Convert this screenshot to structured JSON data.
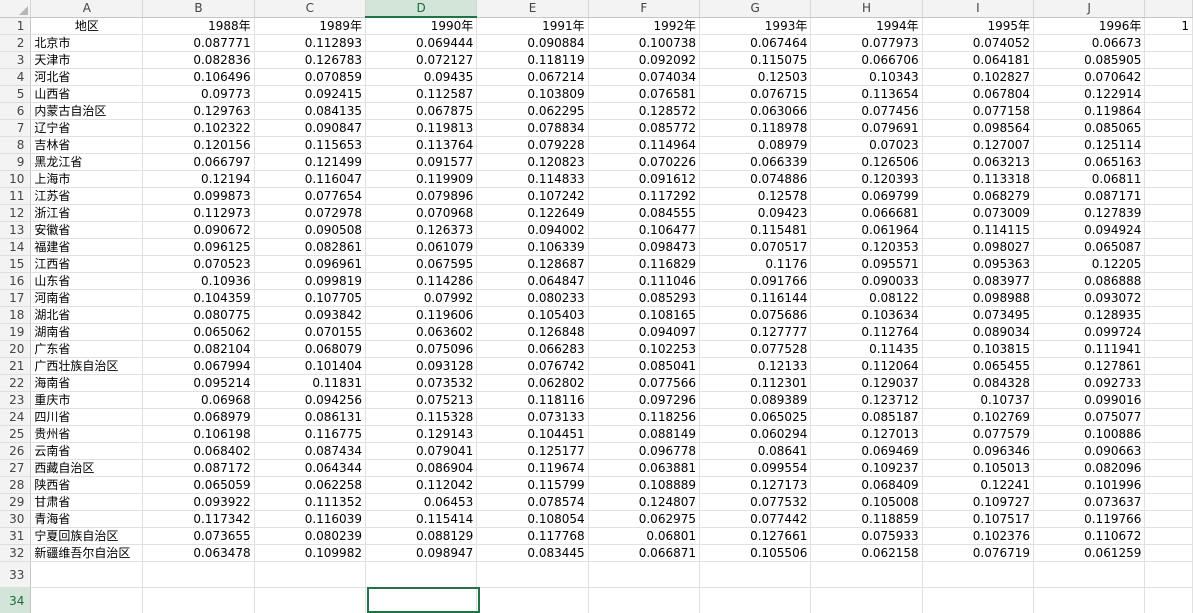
{
  "columns": [
    "A",
    "B",
    "C",
    "D",
    "E",
    "F",
    "G",
    "H",
    "I",
    "J",
    ""
  ],
  "selected_column": "D",
  "selected_row": "34",
  "header_row": [
    "地区",
    "1988年",
    "1989年",
    "1990年",
    "1991年",
    "1992年",
    "1993年",
    "1994年",
    "1995年",
    "1996年",
    "1"
  ],
  "rows": [
    [
      "北京市",
      "0.087771",
      "0.112893",
      "0.069444",
      "0.090884",
      "0.100738",
      "0.067464",
      "0.077973",
      "0.074052",
      "0.06673"
    ],
    [
      "天津市",
      "0.082836",
      "0.126783",
      "0.072127",
      "0.118119",
      "0.092092",
      "0.115075",
      "0.066706",
      "0.064181",
      "0.085905"
    ],
    [
      "河北省",
      "0.106496",
      "0.070859",
      "0.09435",
      "0.067214",
      "0.074034",
      "0.12503",
      "0.10343",
      "0.102827",
      "0.070642"
    ],
    [
      "山西省",
      "0.09773",
      "0.092415",
      "0.112587",
      "0.103809",
      "0.076581",
      "0.076715",
      "0.113654",
      "0.067804",
      "0.122914"
    ],
    [
      "内蒙古自治区",
      "0.129763",
      "0.084135",
      "0.067875",
      "0.062295",
      "0.128572",
      "0.063066",
      "0.077456",
      "0.077158",
      "0.119864"
    ],
    [
      "辽宁省",
      "0.102322",
      "0.090847",
      "0.119813",
      "0.078834",
      "0.085772",
      "0.118978",
      "0.079691",
      "0.098564",
      "0.085065"
    ],
    [
      "吉林省",
      "0.120156",
      "0.115653",
      "0.113764",
      "0.079228",
      "0.114964",
      "0.08979",
      "0.07023",
      "0.127007",
      "0.125114"
    ],
    [
      "黑龙江省",
      "0.066797",
      "0.121499",
      "0.091577",
      "0.120823",
      "0.070226",
      "0.066339",
      "0.126506",
      "0.063213",
      "0.065163"
    ],
    [
      "上海市",
      "0.12194",
      "0.116047",
      "0.119909",
      "0.114833",
      "0.091612",
      "0.074886",
      "0.120393",
      "0.113318",
      "0.06811"
    ],
    [
      "江苏省",
      "0.099873",
      "0.077654",
      "0.079896",
      "0.107242",
      "0.117292",
      "0.12578",
      "0.069799",
      "0.068279",
      "0.087171"
    ],
    [
      "浙江省",
      "0.112973",
      "0.072978",
      "0.070968",
      "0.122649",
      "0.084555",
      "0.09423",
      "0.066681",
      "0.073009",
      "0.127839"
    ],
    [
      "安徽省",
      "0.090672",
      "0.090508",
      "0.126373",
      "0.094002",
      "0.106477",
      "0.115481",
      "0.061964",
      "0.114115",
      "0.094924"
    ],
    [
      "福建省",
      "0.096125",
      "0.082861",
      "0.061079",
      "0.106339",
      "0.098473",
      "0.070517",
      "0.120353",
      "0.098027",
      "0.065087"
    ],
    [
      "江西省",
      "0.070523",
      "0.096961",
      "0.067595",
      "0.128687",
      "0.116829",
      "0.1176",
      "0.095571",
      "0.095363",
      "0.12205"
    ],
    [
      "山东省",
      "0.10936",
      "0.099819",
      "0.114286",
      "0.064847",
      "0.111046",
      "0.091766",
      "0.090033",
      "0.083977",
      "0.086888"
    ],
    [
      "河南省",
      "0.104359",
      "0.107705",
      "0.07992",
      "0.080233",
      "0.085293",
      "0.116144",
      "0.08122",
      "0.098988",
      "0.093072"
    ],
    [
      "湖北省",
      "0.080775",
      "0.093842",
      "0.119606",
      "0.105403",
      "0.108165",
      "0.075686",
      "0.103634",
      "0.073495",
      "0.128935"
    ],
    [
      "湖南省",
      "0.065062",
      "0.070155",
      "0.063602",
      "0.126848",
      "0.094097",
      "0.127777",
      "0.112764",
      "0.089034",
      "0.099724"
    ],
    [
      "广东省",
      "0.082104",
      "0.068079",
      "0.075096",
      "0.066283",
      "0.102253",
      "0.077528",
      "0.11435",
      "0.103815",
      "0.111941"
    ],
    [
      "广西壮族自治区",
      "0.067994",
      "0.101404",
      "0.093128",
      "0.076742",
      "0.085041",
      "0.12133",
      "0.112064",
      "0.065455",
      "0.127861"
    ],
    [
      "海南省",
      "0.095214",
      "0.11831",
      "0.073532",
      "0.062802",
      "0.077566",
      "0.112301",
      "0.129037",
      "0.084328",
      "0.092733"
    ],
    [
      "重庆市",
      "0.06968",
      "0.094256",
      "0.075213",
      "0.118116",
      "0.097296",
      "0.089389",
      "0.123712",
      "0.10737",
      "0.099016"
    ],
    [
      "四川省",
      "0.068979",
      "0.086131",
      "0.115328",
      "0.073133",
      "0.118256",
      "0.065025",
      "0.085187",
      "0.102769",
      "0.075077"
    ],
    [
      "贵州省",
      "0.106198",
      "0.116775",
      "0.129143",
      "0.104451",
      "0.088149",
      "0.060294",
      "0.127013",
      "0.077579",
      "0.100886"
    ],
    [
      "云南省",
      "0.068402",
      "0.087434",
      "0.079041",
      "0.125177",
      "0.096778",
      "0.08641",
      "0.069469",
      "0.096346",
      "0.090663"
    ],
    [
      "西藏自治区",
      "0.087172",
      "0.064344",
      "0.086904",
      "0.119674",
      "0.063881",
      "0.099554",
      "0.109237",
      "0.105013",
      "0.082096"
    ],
    [
      "陕西省",
      "0.065059",
      "0.062258",
      "0.112042",
      "0.115799",
      "0.108889",
      "0.127173",
      "0.068409",
      "0.12241",
      "0.101996"
    ],
    [
      "甘肃省",
      "0.093922",
      "0.111352",
      "0.06453",
      "0.078574",
      "0.124807",
      "0.077532",
      "0.105008",
      "0.109727",
      "0.073637"
    ],
    [
      "青海省",
      "0.117342",
      "0.116039",
      "0.115414",
      "0.108054",
      "0.062975",
      "0.077442",
      "0.118859",
      "0.107517",
      "0.119766"
    ],
    [
      "宁夏回族自治区",
      "0.073655",
      "0.080239",
      "0.088129",
      "0.117768",
      "0.06801",
      "0.127661",
      "0.075933",
      "0.102376",
      "0.110672"
    ],
    [
      "新疆维吾尔自治区",
      "0.063478",
      "0.109982",
      "0.098947",
      "0.083445",
      "0.066871",
      "0.105506",
      "0.062158",
      "0.076719",
      "0.061259"
    ]
  ],
  "empty_rows": [
    "33",
    "34"
  ],
  "colors": {
    "accent": "#217346",
    "selected_header_bg": "#d3e4d8",
    "grid": "#e1e1e1"
  }
}
